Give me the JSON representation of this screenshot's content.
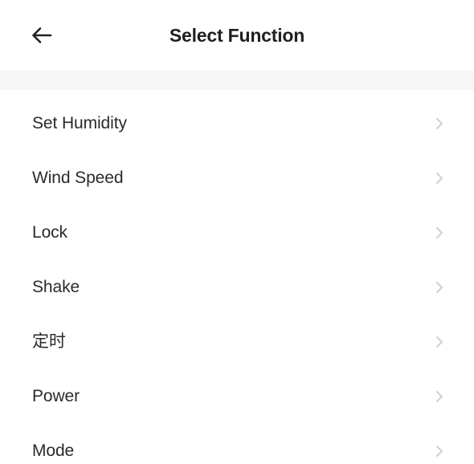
{
  "header": {
    "title": "Select Function",
    "back_icon": "arrow-left-icon"
  },
  "functions": [
    {
      "label": "Set Humidity",
      "icon": "chevron-right-icon"
    },
    {
      "label": "Wind Speed",
      "icon": "chevron-right-icon"
    },
    {
      "label": "Lock",
      "icon": "chevron-right-icon"
    },
    {
      "label": "Shake",
      "icon": "chevron-right-icon"
    },
    {
      "label": "定时",
      "icon": "chevron-right-icon"
    },
    {
      "label": "Power",
      "icon": "chevron-right-icon"
    },
    {
      "label": "Mode",
      "icon": "chevron-right-icon"
    }
  ],
  "colors": {
    "text": "#1f1f1f",
    "separator": "#f6f6f6",
    "chevron": "#d0d0d0",
    "background": "#ffffff"
  }
}
